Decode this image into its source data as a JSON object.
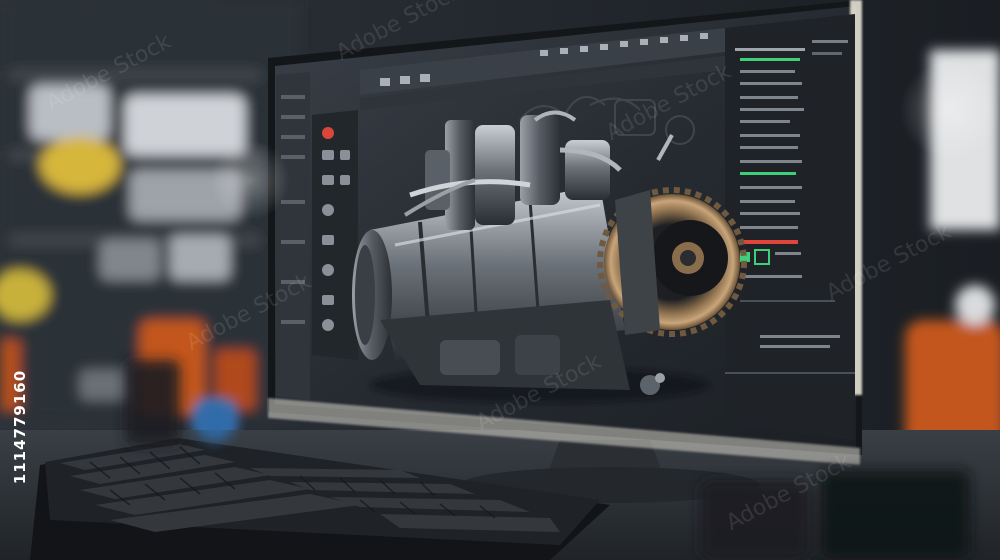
{
  "photo": {
    "description_name": "engine-cad-on-monitor",
    "stock_id": "1114779160"
  },
  "colors": {
    "background": "#1b1f24",
    "screen_bg": "#23282e",
    "accent_green": "#3fcf7a",
    "accent_orange": "#e0702a",
    "accent_red": "#e0453a",
    "accent_yellow": "#e8c440",
    "engine_metal": "#8c9198",
    "engine_gold": "#b8946a"
  },
  "watermark": {
    "text": "Adobe Stock"
  }
}
